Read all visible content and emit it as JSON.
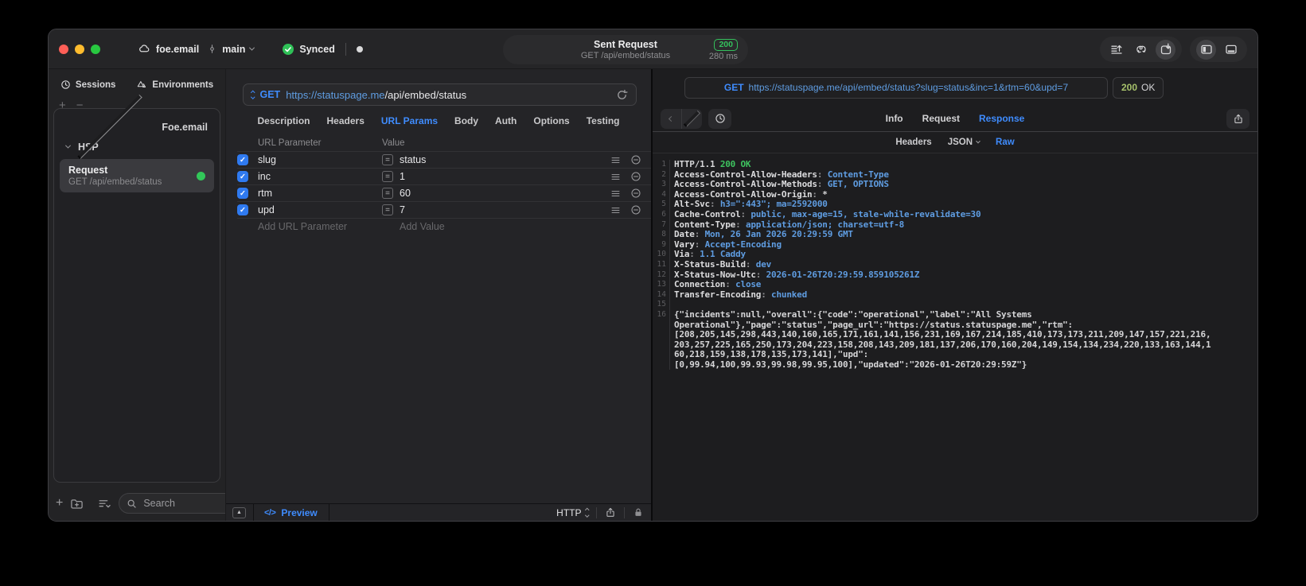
{
  "titlebar": {
    "project": "foe.email",
    "branch": "main",
    "sync_label": "Synced",
    "request": {
      "title": "Sent Request",
      "subtitle": "GET /api/embed/status",
      "status_code": "200",
      "duration": "280 ms"
    }
  },
  "sidebar": {
    "tabs": [
      {
        "label": "Sessions"
      },
      {
        "label": "Environments"
      }
    ],
    "add_glyph": "+",
    "remove_glyph": "−",
    "groups": [
      {
        "label": "Foe.email",
        "expanded": false
      },
      {
        "label": "HSP",
        "expanded": true
      }
    ],
    "request_item": {
      "title": "Request",
      "subtitle": "GET /api/embed/status"
    },
    "search_placeholder": "Search"
  },
  "request_editor": {
    "method": "GET",
    "url_host": "https://statuspage.me",
    "url_path": "/api/embed/status",
    "tabs": [
      "Description",
      "Headers",
      "URL Params",
      "Body",
      "Auth",
      "Options",
      "Testing"
    ],
    "active_tab": "URL Params",
    "params": {
      "name_header": "URL Parameter",
      "value_header": "Value",
      "equals_glyph": "=",
      "check_glyph": "✓",
      "rows": [
        {
          "name": "slug",
          "value": "status",
          "enabled": true
        },
        {
          "name": "inc",
          "value": "1",
          "enabled": true
        },
        {
          "name": "rtm",
          "value": "60",
          "enabled": true
        },
        {
          "name": "upd",
          "value": "7",
          "enabled": true
        }
      ],
      "add_name_placeholder": "Add URL Parameter",
      "add_value_placeholder": "Add Value"
    },
    "footer": {
      "collapse_glyph": "▲",
      "code_glyph": "</>",
      "preview_label": "Preview",
      "protocol": "HTTP"
    }
  },
  "response_viewer": {
    "method": "GET",
    "url": "https://statuspage.me/api/embed/status?slug=status&inc=1&rtm=60&upd=7",
    "status_code": "200",
    "status_text": "OK",
    "tabs": [
      "Info",
      "Request",
      "Response"
    ],
    "active_tab": "Response",
    "subtabs": [
      {
        "label": "Headers",
        "dropdown": false
      },
      {
        "label": "JSON",
        "dropdown": true
      },
      {
        "label": "Raw",
        "dropdown": false
      }
    ],
    "active_subtab": "Raw",
    "body_lines": [
      {
        "num": "1",
        "parts": [
          {
            "t": "HTTP/1.1 ",
            "c": "w"
          },
          {
            "t": "200 OK",
            "c": "g"
          }
        ]
      },
      {
        "num": "2",
        "parts": [
          {
            "t": "Access-Control-Allow-Headers",
            "c": "n"
          },
          {
            "t": ": ",
            "c": "p"
          },
          {
            "t": "Content-Type",
            "c": "b"
          }
        ]
      },
      {
        "num": "3",
        "parts": [
          {
            "t": "Access-Control-Allow-Methods",
            "c": "n"
          },
          {
            "t": ": ",
            "c": "p"
          },
          {
            "t": "GET, OPTIONS",
            "c": "b"
          }
        ]
      },
      {
        "num": "4",
        "parts": [
          {
            "t": "Access-Control-Allow-Origin",
            "c": "n"
          },
          {
            "t": ": ",
            "c": "p"
          },
          {
            "t": "*",
            "c": "w"
          }
        ]
      },
      {
        "num": "5",
        "parts": [
          {
            "t": "Alt-Svc",
            "c": "n"
          },
          {
            "t": ": ",
            "c": "p"
          },
          {
            "t": "h3=\":443\"; ma=2592000",
            "c": "b"
          }
        ]
      },
      {
        "num": "6",
        "parts": [
          {
            "t": "Cache-Control",
            "c": "n"
          },
          {
            "t": ": ",
            "c": "p"
          },
          {
            "t": "public, max-age=15, stale-while-revalidate=30",
            "c": "b"
          }
        ]
      },
      {
        "num": "7",
        "parts": [
          {
            "t": "Content-Type",
            "c": "n"
          },
          {
            "t": ": ",
            "c": "p"
          },
          {
            "t": "application/json; charset=utf-8",
            "c": "b"
          }
        ]
      },
      {
        "num": "8",
        "parts": [
          {
            "t": "Date",
            "c": "n"
          },
          {
            "t": ": ",
            "c": "p"
          },
          {
            "t": "Mon, 26 Jan 2026 20:29:59 GMT",
            "c": "b"
          }
        ]
      },
      {
        "num": "9",
        "parts": [
          {
            "t": "Vary",
            "c": "n"
          },
          {
            "t": ": ",
            "c": "p"
          },
          {
            "t": "Accept-Encoding",
            "c": "b"
          }
        ]
      },
      {
        "num": "10",
        "parts": [
          {
            "t": "Via",
            "c": "n"
          },
          {
            "t": ": ",
            "c": "p"
          },
          {
            "t": "1.1 Caddy",
            "c": "b"
          }
        ]
      },
      {
        "num": "11",
        "parts": [
          {
            "t": "X-Status-Build",
            "c": "n"
          },
          {
            "t": ": ",
            "c": "p"
          },
          {
            "t": "dev",
            "c": "b"
          }
        ]
      },
      {
        "num": "12",
        "parts": [
          {
            "t": "X-Status-Now-Utc",
            "c": "n"
          },
          {
            "t": ": ",
            "c": "p"
          },
          {
            "t": "2026-01-26T20:29:59.859105261Z",
            "c": "b"
          }
        ]
      },
      {
        "num": "13",
        "parts": [
          {
            "t": "Connection",
            "c": "n"
          },
          {
            "t": ": ",
            "c": "p"
          },
          {
            "t": "close",
            "c": "b"
          }
        ]
      },
      {
        "num": "14",
        "parts": [
          {
            "t": "Transfer-Encoding",
            "c": "n"
          },
          {
            "t": ": ",
            "c": "p"
          },
          {
            "t": "chunked",
            "c": "b"
          }
        ]
      },
      {
        "num": "15",
        "parts": []
      },
      {
        "num": "16",
        "parts": [
          {
            "t": "{\"incidents\":null,\"overall\":{\"code\":\"operational\",\"label\":\"All Systems",
            "c": "w"
          }
        ]
      },
      {
        "num": "",
        "parts": [
          {
            "t": "Operational\"},\"page\":\"status\",\"page_url\":\"https://status.statuspage.me\",\"rtm\":",
            "c": "w"
          }
        ]
      },
      {
        "num": "",
        "parts": [
          {
            "t": "[208,205,145,298,443,140,160,165,171,161,141,156,231,169,167,214,185,410,173,173,211,209,147,157,221,216,",
            "c": "w"
          }
        ]
      },
      {
        "num": "",
        "parts": [
          {
            "t": "203,257,225,165,250,173,204,223,158,208,143,209,181,137,206,170,160,204,149,154,134,234,220,133,163,144,1",
            "c": "w"
          }
        ]
      },
      {
        "num": "",
        "parts": [
          {
            "t": "60,218,159,138,178,135,173,141],\"upd\":",
            "c": "w"
          }
        ]
      },
      {
        "num": "",
        "parts": [
          {
            "t": "[0,99.94,100,99.93,99.98,99.95,100],\"updated\":\"2026-01-26T20:29:59Z\"}",
            "c": "w"
          }
        ]
      }
    ]
  }
}
